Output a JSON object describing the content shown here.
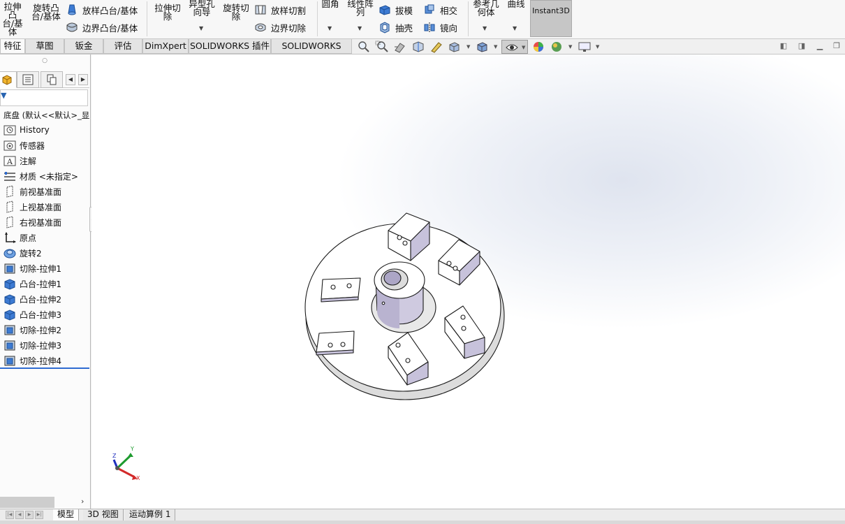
{
  "ribbon": {
    "big": [
      {
        "id": "extrude-boss",
        "line1": "拉伸凸",
        "line2": "台/基体"
      },
      {
        "id": "revolve-boss",
        "line1": "旋转凸",
        "line2": "台/基体"
      },
      {
        "id": "extrude-cut",
        "line1": "拉伸切",
        "line2": "除"
      },
      {
        "id": "hole-wizard",
        "line1": "异型孔",
        "line2": "向导"
      },
      {
        "id": "revolve-cut",
        "line1": "旋转切",
        "line2": "除"
      },
      {
        "id": "fillet",
        "line1": "圆角",
        "line2": ""
      },
      {
        "id": "linear-pattern",
        "line1": "线性阵",
        "line2": "列"
      },
      {
        "id": "ref-geometry",
        "line1": "参考几",
        "line2": "何体"
      },
      {
        "id": "curves",
        "line1": "曲线",
        "line2": ""
      }
    ],
    "small": {
      "loft_boss": "放样凸台/基体",
      "boundary_boss": "边界凸台/基体",
      "loft_cut": "放样切割",
      "boundary_cut": "边界切除",
      "draft": "拔模",
      "shell": "抽壳",
      "intersect": "相交",
      "mirror": "镜向"
    },
    "instant3d": "Instant3D"
  },
  "tabs": [
    "特征",
    "草图",
    "钣金",
    "评估",
    "DimXpert",
    "SOLIDWORKS 插件",
    "SOLIDWORKS MBD"
  ],
  "tree": {
    "root": "底盘 (默认<<默认>_显",
    "items": [
      {
        "label": "History",
        "icon": "history-icon"
      },
      {
        "label": "传感器",
        "icon": "sensor-icon"
      },
      {
        "label": "注解",
        "icon": "annotation-icon"
      },
      {
        "label": "材质 <未指定>",
        "icon": "material-icon"
      },
      {
        "label": "前视基准面",
        "icon": "plane-icon"
      },
      {
        "label": "上视基准面",
        "icon": "plane-icon"
      },
      {
        "label": "右视基准面",
        "icon": "plane-icon"
      },
      {
        "label": "原点",
        "icon": "origin-icon"
      },
      {
        "label": "旋转2",
        "icon": "revolve-icon"
      },
      {
        "label": "切除-拉伸1",
        "icon": "cut-extrude-icon"
      },
      {
        "label": "凸台-拉伸1",
        "icon": "boss-extrude-icon"
      },
      {
        "label": "凸台-拉伸2",
        "icon": "boss-extrude-icon"
      },
      {
        "label": "凸台-拉伸3",
        "icon": "boss-extrude-icon"
      },
      {
        "label": "切除-拉伸2",
        "icon": "cut-extrude-icon"
      },
      {
        "label": "切除-拉伸3",
        "icon": "cut-extrude-icon"
      },
      {
        "label": "切除-拉伸4",
        "icon": "cut-extrude-icon"
      }
    ]
  },
  "bottom_tabs": [
    "模型",
    "3D 视图",
    "运动算例 1"
  ],
  "triad": {
    "x": "X",
    "y": "Y",
    "z": "Z"
  },
  "colors": {
    "accent": "#2e6bd1",
    "part_face": "#ffffff",
    "part_shade": "#c8c4dc",
    "edge": "#1a1a1a"
  }
}
